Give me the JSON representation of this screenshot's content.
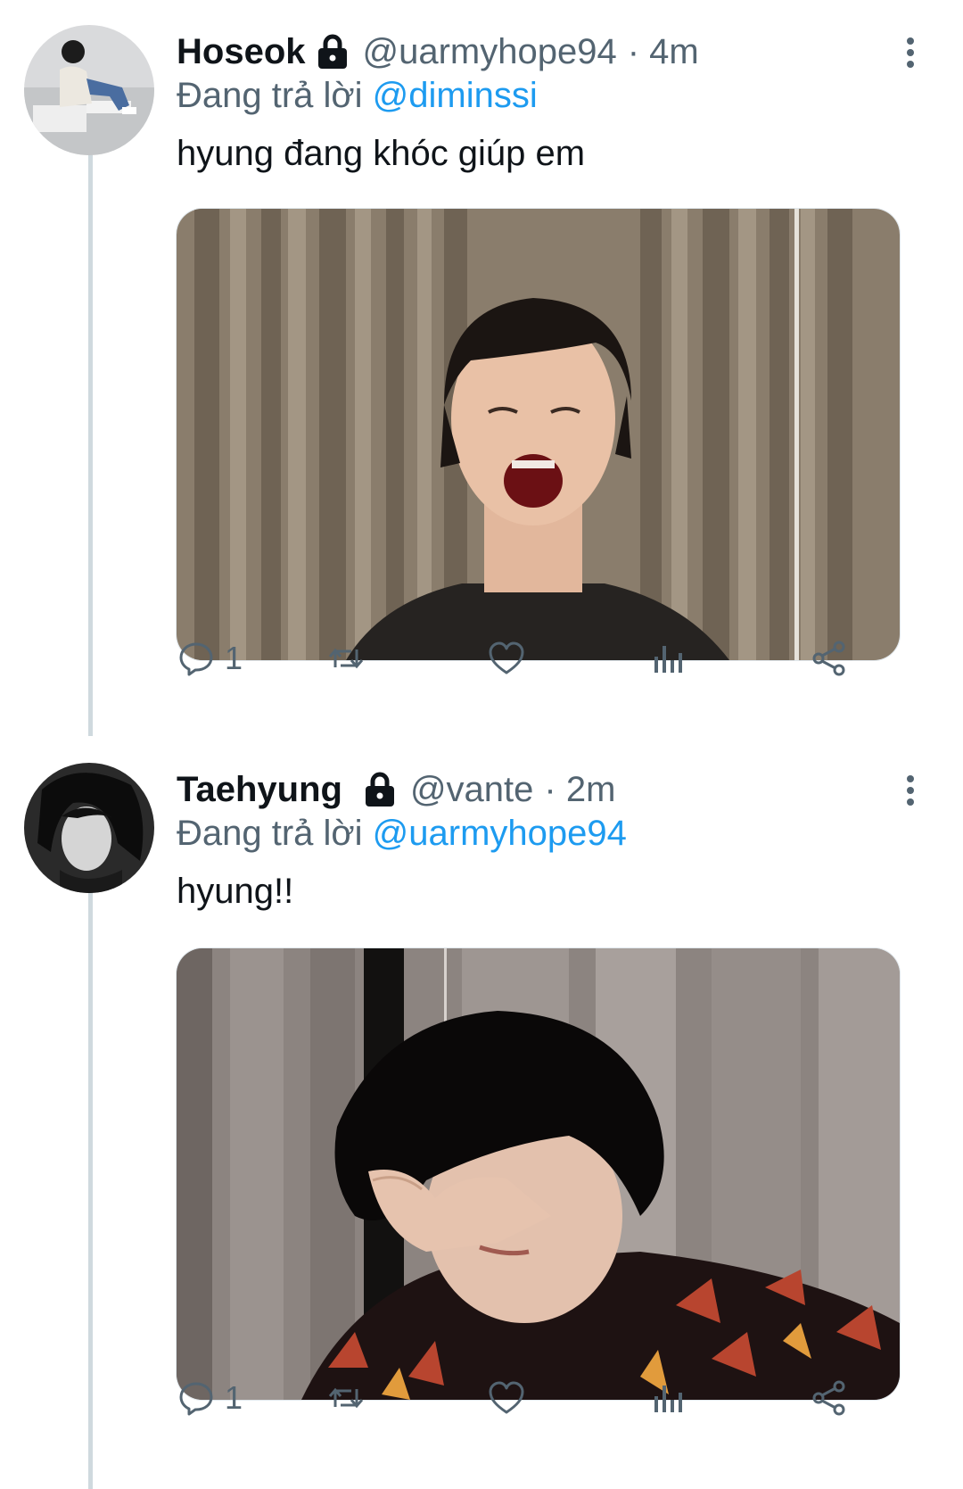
{
  "tweets": [
    {
      "name": "Hoseok",
      "handle": "@uarmyhope94",
      "time": "· 4m",
      "replying_prefix": "Đang trả lời ",
      "replying_to": "@diminssi",
      "text": "hyung đang khóc giúp em",
      "reply_count": "1"
    },
    {
      "name": "Taehyung",
      "handle": "@vante",
      "time": "· 2m",
      "replying_prefix": "Đang trả lời ",
      "replying_to": "@uarmyhope94",
      "text": "hyung!!",
      "reply_count": "1"
    }
  ],
  "icons": {
    "lock": "lock-icon",
    "more": "more-vertical-icon",
    "reply": "reply-icon",
    "retweet": "retweet-icon",
    "like": "heart-icon",
    "analytics": "analytics-icon",
    "share": "share-icon"
  },
  "colors": {
    "link": "#1d9bf0",
    "secondary": "#536471",
    "thread_line": "#cfd9de"
  }
}
